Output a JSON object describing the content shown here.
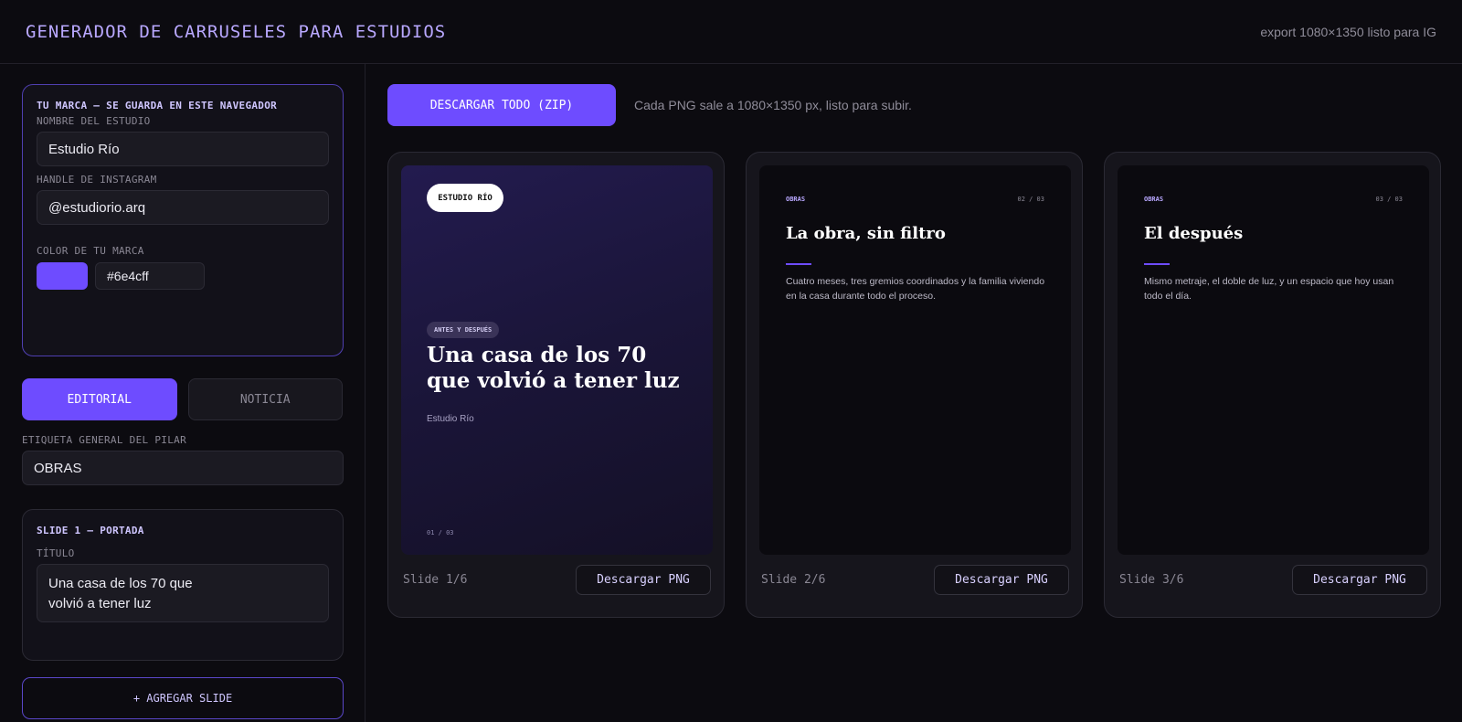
{
  "app": {
    "title": "GENERADOR DE CARRUSELES PARA ESTUDIOS",
    "export_note": "export 1080×1350 listo para IG"
  },
  "brand": {
    "section_title": "TU MARCA — SE GUARDA EN ESTE NAVEGADOR",
    "studio_label": "NOMBRE DEL ESTUDIO",
    "studio_value": "Estudio Río",
    "handle_label": "HANDLE DE INSTAGRAM",
    "handle_value": "@estudiorio.arq",
    "color_label": "COLOR DE TU MARCA",
    "color_value": "#6e4cff"
  },
  "modes": {
    "active": "EDITORIAL",
    "inactive": "NOTICIA"
  },
  "pillar": {
    "label": "ETIQUETA GENERAL DEL PILAR",
    "value": "OBRAS"
  },
  "slide_editor": {
    "title": "SLIDE 1 — PORTADA",
    "field_label": "TÍTULO",
    "line1": "Una casa de los 70 que",
    "line2": "volvió a tener luz"
  },
  "add_slide_label": "+ AGREGAR SLIDE",
  "toolbar": {
    "download_all": "DESCARGAR TODO (ZIP)",
    "note": "Cada PNG sale a 1080×1350 px, listo para subir."
  },
  "cards": [
    {
      "type": "cover",
      "pill": "ESTUDIO RÍO",
      "tag": "ANTES Y DESPUÉS",
      "title": "Una casa de los 70 que volvió a tener luz",
      "studio": "Estudio Río",
      "counter": "01 / 03",
      "footer": "Slide 1/6",
      "button": "Descargar PNG"
    },
    {
      "type": "content",
      "label": "OBRAS",
      "counter": "02 / 03",
      "heading": "La obra, sin filtro",
      "body": "Cuatro meses, tres gremios coordinados y la familia viviendo en la casa durante todo el proceso.",
      "footer": "Slide 2/6",
      "button": "Descargar PNG"
    },
    {
      "type": "content",
      "label": "OBRAS",
      "counter": "03 / 03",
      "heading": "El después",
      "body": "Mismo metraje, el doble de luz, y un espacio que hoy usan todo el día.",
      "footer": "Slide 3/6",
      "button": "Descargar PNG"
    }
  ],
  "colors": {
    "accent": "#6e4cff",
    "background": "#0c0b10"
  }
}
